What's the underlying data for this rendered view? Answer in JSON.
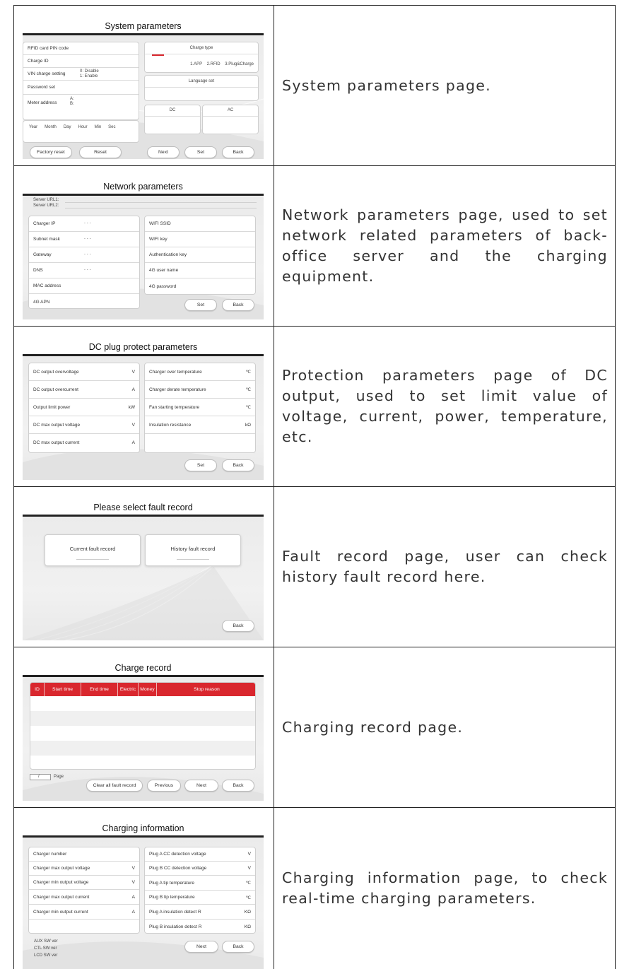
{
  "rows": [
    {
      "description": "System parameters page.",
      "screen": {
        "title": "System parameters",
        "left_fields": [
          "RFID card PIN code",
          "Charge ID",
          "VIN charge setting",
          "Password set",
          "Meter address"
        ],
        "vin_options": [
          "0: Disable",
          "1: Enable"
        ],
        "meter_labels": [
          "A:",
          "B:"
        ],
        "time_labels": [
          "Year",
          "Month",
          "Day",
          "Hour",
          "Min",
          "Sec"
        ],
        "charge_type_label": "Charge type",
        "charge_type_options": "1.APP    2.RFID    3.Plug&Charge",
        "language_label": "Language set",
        "dc_label": "DC",
        "ac_label": "AC",
        "buttons": [
          "Factory reset",
          "Reset",
          "Next",
          "Set",
          "Back"
        ]
      }
    },
    {
      "description": "Network parameters page, used to set network related parameters of back-office server and the charging equipment.",
      "screen": {
        "title": "Network parameters",
        "server_url1": "Server URL1:",
        "server_url2": "Server URL2:",
        "left_fields": [
          "Charger IP",
          "Subnet mask",
          "Gateway",
          "DNS",
          "MAC address",
          "4G APN"
        ],
        "ip_dots": ".      .      .",
        "right_fields": [
          "WIFI SSID",
          "WIFI key",
          "Authentication key",
          "4G user name",
          "4G password"
        ],
        "buttons": [
          "Set",
          "Back"
        ]
      }
    },
    {
      "description": "Protection parameters page of DC output, used to set limit value of voltage, current, power, temperature, etc.",
      "screen": {
        "title": "DC plug protect parameters",
        "left_fields": [
          {
            "label": "DC output overvoltage",
            "unit": "V"
          },
          {
            "label": "DC output overcurrent",
            "unit": "A"
          },
          {
            "label": "Output limit power",
            "unit": "kW"
          },
          {
            "label": "DC max output voltage",
            "unit": "V"
          },
          {
            "label": "DC max output current",
            "unit": "A"
          }
        ],
        "right_fields": [
          {
            "label": "Charger over temperature",
            "unit": "℃"
          },
          {
            "label": "Charger derate temperature",
            "unit": "℃"
          },
          {
            "label": "Fan starting temperature",
            "unit": "℃"
          },
          {
            "label": "Insulation resistance",
            "unit": "kΩ"
          }
        ],
        "buttons": [
          "Set",
          "Back"
        ]
      }
    },
    {
      "description": "Fault record page, user can check history fault record here.",
      "screen": {
        "title": "Please select fault record",
        "options": [
          "Current fault record",
          "History fault record"
        ],
        "buttons": [
          "Back"
        ]
      }
    },
    {
      "description": "Charging record page.",
      "screen": {
        "title": "Charge record",
        "columns": [
          "ID",
          "Start time",
          "End time",
          "Electric",
          "Money",
          "Stop reason"
        ],
        "page_sep": "/",
        "page_label": "Page",
        "buttons": [
          "Clear all fault record",
          "Previous",
          "Next",
          "Back"
        ]
      }
    },
    {
      "description": "Charging information page, to check real-time charging parameters.",
      "screen": {
        "title": "Charging information",
        "left_fields": [
          {
            "label": "Charger number",
            "unit": ""
          },
          {
            "label": "Charger max output voltage",
            "unit": "V"
          },
          {
            "label": "Charger min output voltage",
            "unit": "V"
          },
          {
            "label": "Charger max output current",
            "unit": "A"
          },
          {
            "label": "Charger min output current",
            "unit": "A"
          }
        ],
        "right_fields": [
          {
            "label": "Plug A CC detection voltage",
            "unit": "V"
          },
          {
            "label": "Plug B CC detection voltage",
            "unit": "V"
          },
          {
            "label": "Plug A tip temperature",
            "unit": "℃"
          },
          {
            "label": "Plug B tip temperature",
            "unit": "℃"
          },
          {
            "label": "Plug A insulation detect R",
            "unit": "KΩ"
          },
          {
            "label": "Plug B insulation detect R",
            "unit": "KΩ"
          }
        ],
        "versions": [
          "AUX SW ver",
          "CTL SW ver",
          "LCD SW ver"
        ],
        "buttons": [
          "Next",
          "Back"
        ]
      }
    }
  ],
  "colors": {
    "accent_red": "#d9272e",
    "border": "#222222",
    "screen_bg": "#ececec"
  }
}
